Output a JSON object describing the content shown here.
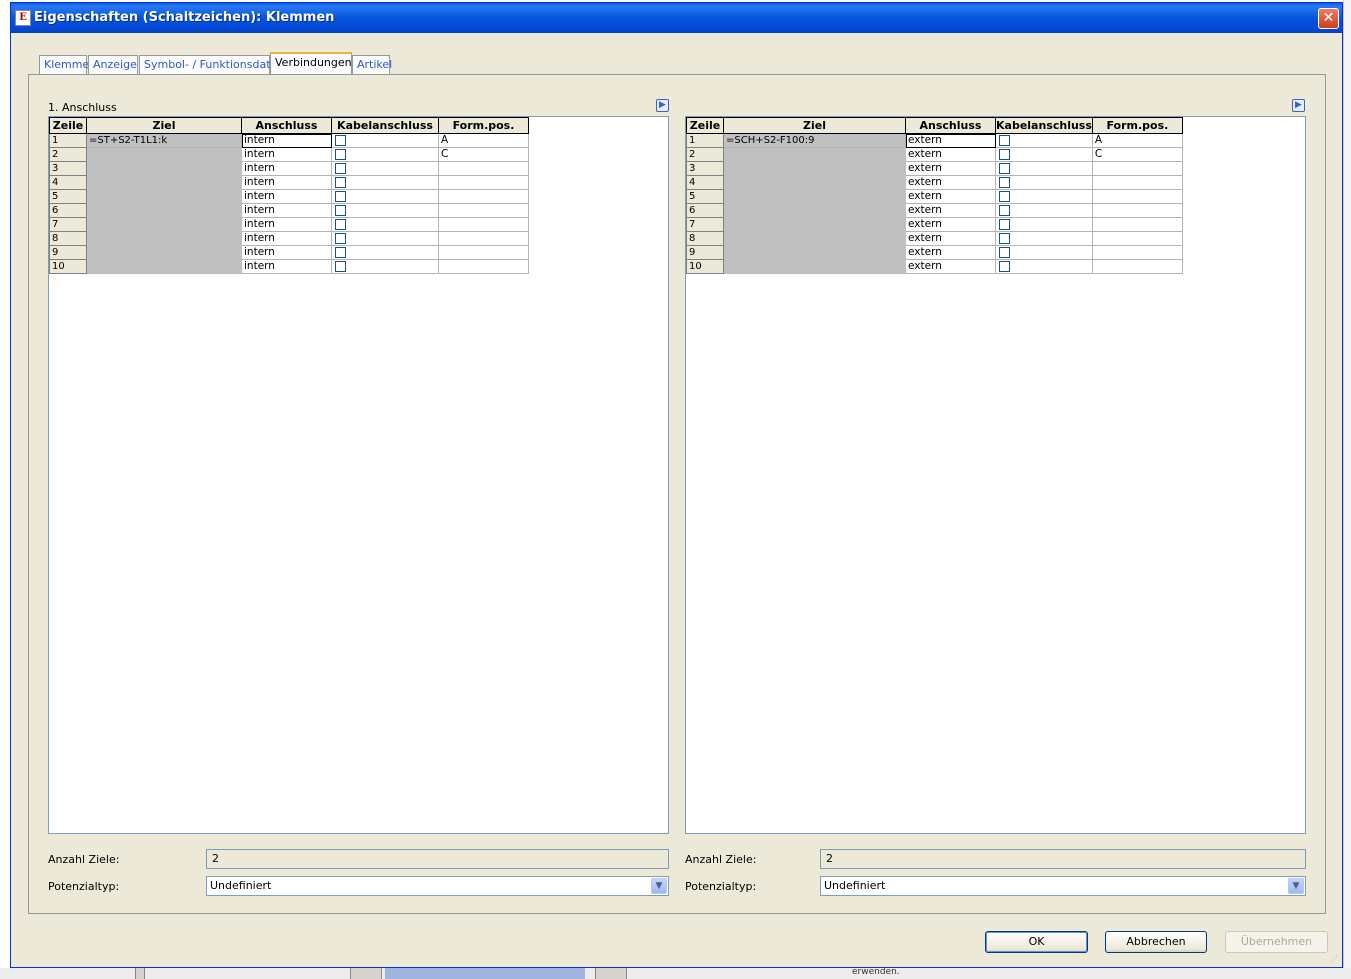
{
  "window": {
    "title": "Eigenschaften (Schaltzeichen): Klemmen",
    "icon": "app-icon",
    "close_label": "✕"
  },
  "tabs": [
    {
      "label": "Klemme"
    },
    {
      "label": "Anzeige"
    },
    {
      "label": "Symbol- / Funktionsdaten"
    },
    {
      "label": "Verbindungen",
      "active": true
    },
    {
      "label": "Artikel"
    }
  ],
  "left": {
    "section_label": "1. Anschluss",
    "columns": [
      "Zeile",
      "Ziel",
      "Anschluss",
      "Kabelanschluss",
      "Form.pos."
    ],
    "rows": [
      {
        "zeile": "1",
        "ziel": "=ST+S2-T1L1:k",
        "anschluss": "intern",
        "form": "A"
      },
      {
        "zeile": "2",
        "ziel": "",
        "anschluss": "intern",
        "form": "C"
      },
      {
        "zeile": "3",
        "ziel": "",
        "anschluss": "intern",
        "form": ""
      },
      {
        "zeile": "4",
        "ziel": "",
        "anschluss": "intern",
        "form": ""
      },
      {
        "zeile": "5",
        "ziel": "",
        "anschluss": "intern",
        "form": ""
      },
      {
        "zeile": "6",
        "ziel": "",
        "anschluss": "intern",
        "form": ""
      },
      {
        "zeile": "7",
        "ziel": "",
        "anschluss": "intern",
        "form": ""
      },
      {
        "zeile": "8",
        "ziel": "",
        "anschluss": "intern",
        "form": ""
      },
      {
        "zeile": "9",
        "ziel": "",
        "anschluss": "intern",
        "form": ""
      },
      {
        "zeile": "10",
        "ziel": "",
        "anschluss": "intern",
        "form": ""
      }
    ],
    "anzahl_label": "Anzahl Ziele:",
    "anzahl_value": "2",
    "potenzial_label": "Potenzialtyp:",
    "potenzial_value": "Undefiniert"
  },
  "right": {
    "section_label": "",
    "columns": [
      "Zeile",
      "Ziel",
      "Anschluss",
      "Kabelanschluss",
      "Form.pos."
    ],
    "rows": [
      {
        "zeile": "1",
        "ziel": "=SCH+S2-F100:9",
        "anschluss": "extern",
        "form": "A"
      },
      {
        "zeile": "2",
        "ziel": "",
        "anschluss": "extern",
        "form": "C"
      },
      {
        "zeile": "3",
        "ziel": "",
        "anschluss": "extern",
        "form": ""
      },
      {
        "zeile": "4",
        "ziel": "",
        "anschluss": "extern",
        "form": ""
      },
      {
        "zeile": "5",
        "ziel": "",
        "anschluss": "extern",
        "form": ""
      },
      {
        "zeile": "6",
        "ziel": "",
        "anschluss": "extern",
        "form": ""
      },
      {
        "zeile": "7",
        "ziel": "",
        "anschluss": "extern",
        "form": ""
      },
      {
        "zeile": "8",
        "ziel": "",
        "anschluss": "extern",
        "form": ""
      },
      {
        "zeile": "9",
        "ziel": "",
        "anschluss": "extern",
        "form": ""
      },
      {
        "zeile": "10",
        "ziel": "",
        "anschluss": "extern",
        "form": ""
      }
    ],
    "anzahl_label": "Anzahl Ziele:",
    "anzahl_value": "2",
    "potenzial_label": "Potenzialtyp:",
    "potenzial_value": "Undefiniert"
  },
  "buttons": {
    "ok": "OK",
    "cancel": "Abbrechen",
    "apply": "Übernehmen"
  },
  "background": {
    "snippet": "erwenden."
  },
  "colors": {
    "title_blue": "#0554e1",
    "ziel_gray": "#c0c0c0",
    "dialog_bg": "#ece9d8",
    "tab_text": "#2a58c4"
  }
}
